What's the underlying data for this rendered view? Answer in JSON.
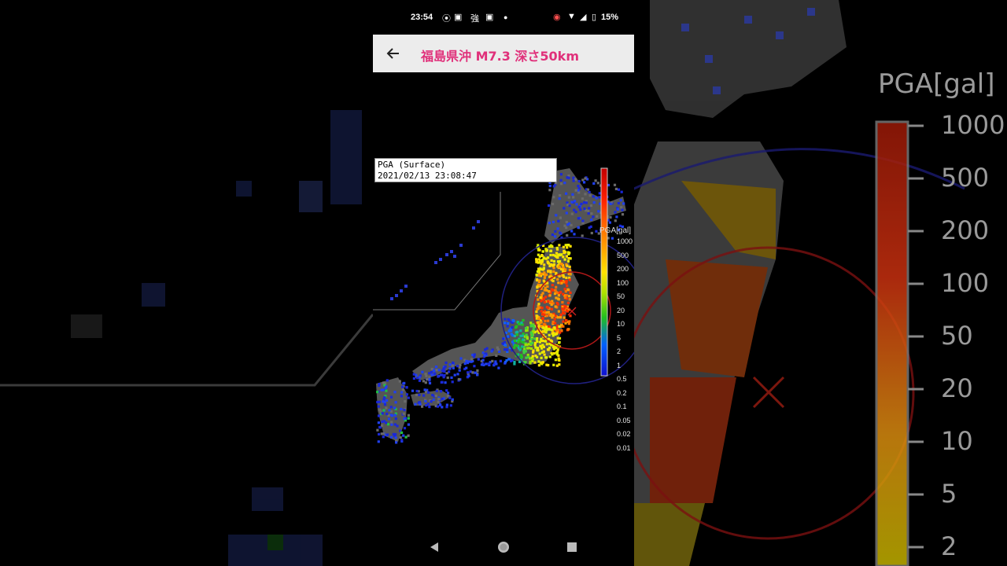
{
  "status_bar": {
    "time": "23:54",
    "icons": [
      "record-icon",
      "app-icon",
      "kanji-notification-icon",
      "app-icon",
      "dot-icon"
    ],
    "kanji_icon_text": "強",
    "battery_percent": "15%",
    "right_icons": [
      "cast-icon",
      "wifi-icon",
      "signal-icon",
      "battery-icon"
    ]
  },
  "app_bar": {
    "title": "福島県沖 M7.3 深さ50km",
    "back_icon": "arrow-left-icon"
  },
  "map": {
    "info_line1": "PGA (Surface)",
    "info_line2": "2021/02/13 23:08:47",
    "legend_title": "PGA[gal]",
    "legend_ticks": [
      "1000",
      "500",
      "200",
      "100",
      "50",
      "20",
      "10",
      "5",
      "2",
      "1",
      "0.5",
      "0.2",
      "0.1",
      "0.05",
      "0.02",
      "0.01"
    ],
    "legend_colors": [
      "#c00000",
      "#ff2000",
      "#ff8000",
      "#ffe000",
      "#b0e000",
      "#20c020",
      "#0060ff",
      "#1010d0"
    ],
    "epicenter_marker": "x-icon"
  },
  "backdrop": {
    "legend_title": "PGA[gal]",
    "legend_ticks": [
      "1000",
      "500",
      "200",
      "100",
      "50",
      "20",
      "10",
      "5",
      "2"
    ]
  },
  "nav_bar": {
    "buttons": [
      "back-triangle-icon",
      "home-circle-icon",
      "recents-square-icon"
    ]
  }
}
